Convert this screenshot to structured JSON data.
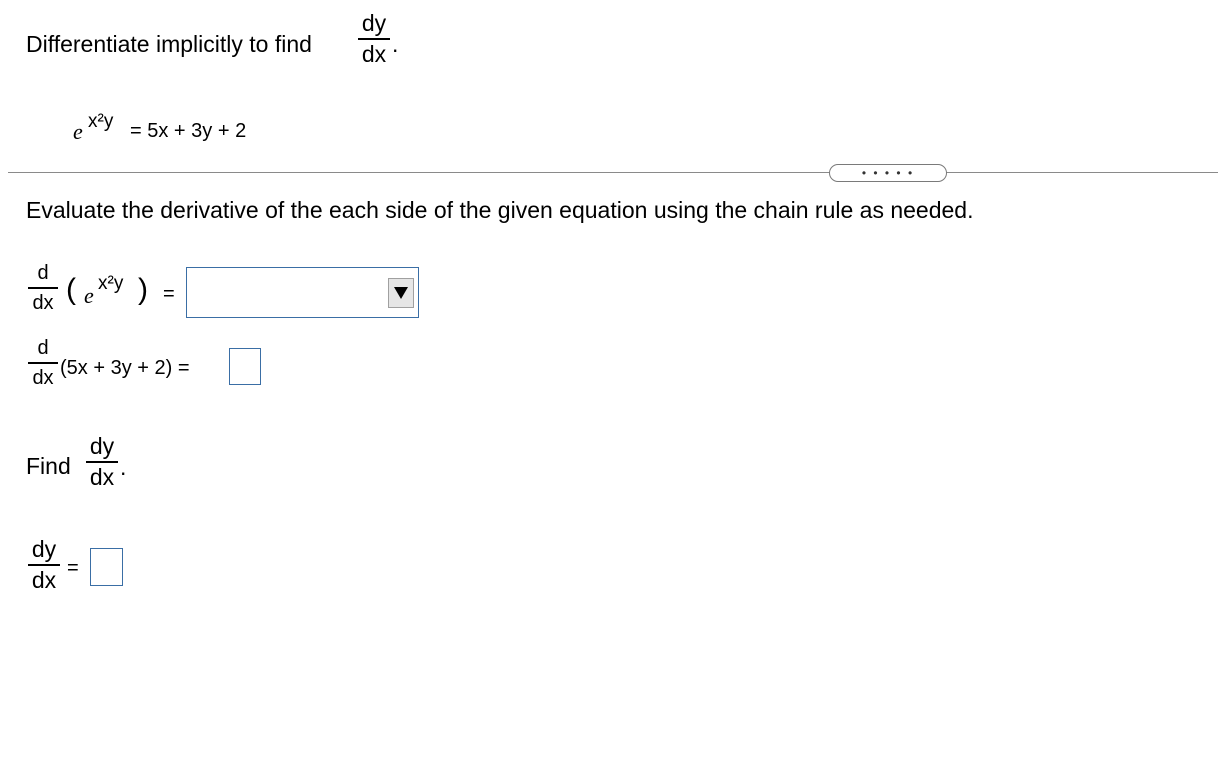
{
  "question": {
    "prompt": "Differentiate implicitly to find",
    "frac_num": "dy",
    "frac_den": "dx",
    "period": ".",
    "equation": {
      "e": "e",
      "exponent": "x²y",
      "rhs": "= 5x + 3y + 2"
    }
  },
  "expander_label": "• • • • •",
  "step": {
    "instruction": "Evaluate the derivative of the each side of the given equation using the chain rule as needed.",
    "line1": {
      "d_num": "d",
      "d_den": "dx",
      "e": "e",
      "exponent": "x²y",
      "equals": "=",
      "dropdown_value": ""
    },
    "line2": {
      "d_num": "d",
      "d_den": "dx",
      "expr": "(5x + 3y + 2) =",
      "answer": ""
    },
    "find": {
      "label": "Find",
      "frac_num": "dy",
      "frac_den": "dx",
      "period": "."
    },
    "final": {
      "frac_num": "dy",
      "frac_den": "dx",
      "equals": "=",
      "answer": ""
    }
  }
}
